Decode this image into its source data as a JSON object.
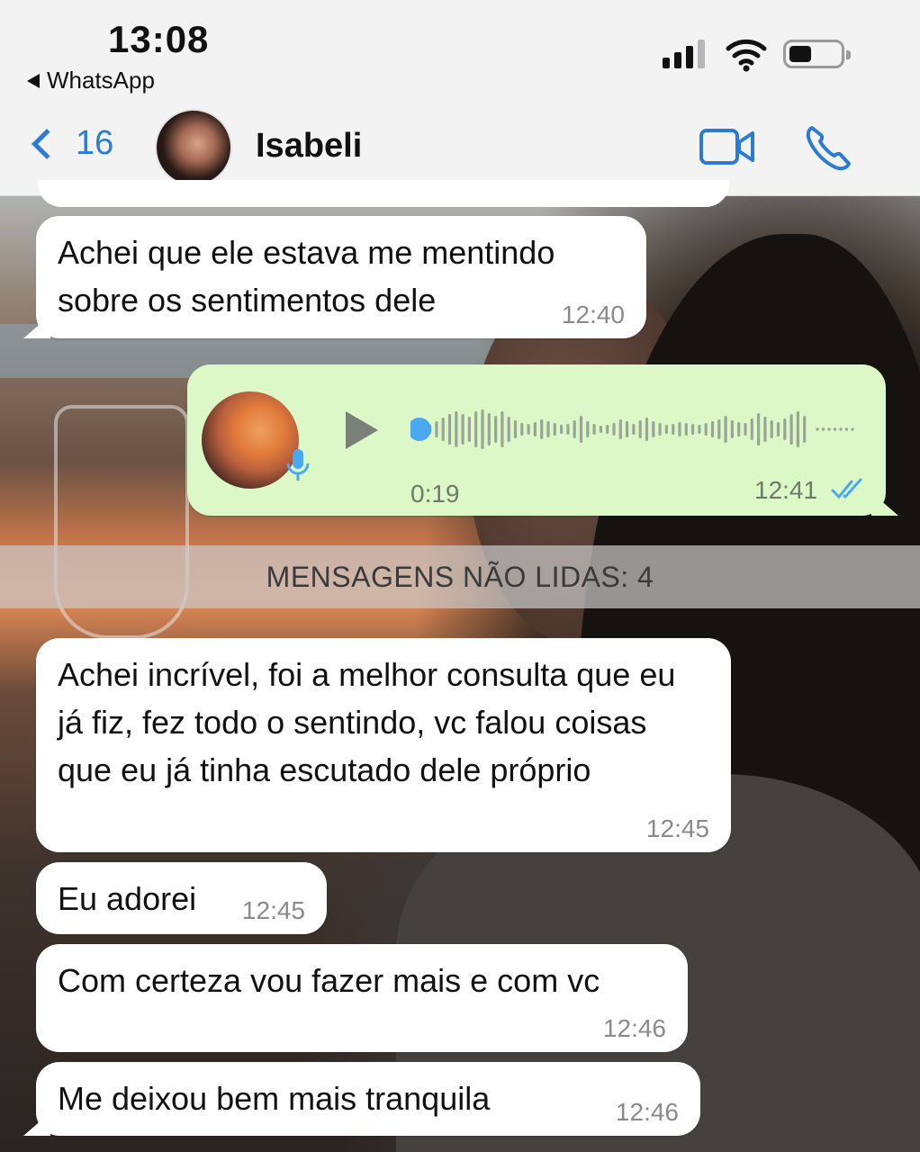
{
  "status_bar": {
    "time": "13:08",
    "back_app": "WhatsApp"
  },
  "header": {
    "back_count": "16",
    "contact_name": "Isabeli"
  },
  "messages": [
    {
      "text": "Achei que ele estava me mentindo sobre os sentimentos dele",
      "time": "12:40"
    },
    {
      "text": "Achei incrível, foi a melhor consulta que eu já fiz, fez todo o sentindo, vc falou coisas que eu já tinha escutado dele próprio",
      "time": "12:45"
    },
    {
      "text": "Eu adorei",
      "time": "12:45"
    },
    {
      "text": "Com certeza vou fazer mais e com vc",
      "time": "12:46"
    },
    {
      "text": "Me deixou bem mais tranquila",
      "time": "12:46"
    }
  ],
  "voice_message": {
    "duration": "0:19",
    "time": "12:41",
    "played_fraction": 0
  },
  "unread_banner": "MENSAGENS NÃO LIDAS: 4",
  "colors": {
    "accent": "#2b7bd2",
    "outgoing_bubble": "#dcf8c6",
    "incoming_bubble": "#ffffff",
    "voice_progress_dot": "#4aa8f0",
    "read_ticks": "#4aa8f0"
  },
  "icons": [
    "back-chevron-icon",
    "video-call-icon",
    "phone-icon",
    "play-icon",
    "microphone-icon",
    "double-check-icon"
  ]
}
